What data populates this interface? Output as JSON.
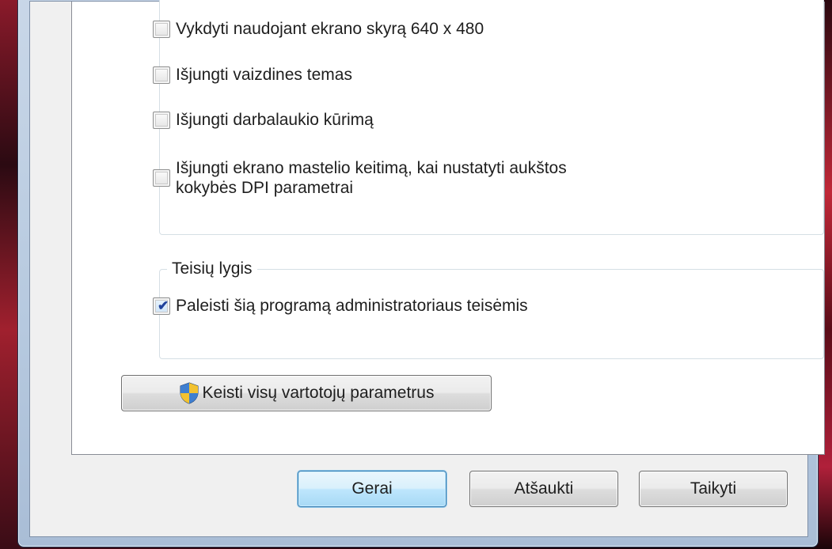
{
  "options": [
    {
      "label": "Vykdyti naudojant ekrano skyrą 640 x 480",
      "checked": false
    },
    {
      "label": "Išjungti vaizdines temas",
      "checked": false
    },
    {
      "label": "Išjungti darbalaukio kūrimą",
      "checked": false
    },
    {
      "label_line1": "Išjungti ekrano mastelio keitimą, kai nustatyti aukštos",
      "label_line2": "kokybės DPI parametrai",
      "checked": false
    }
  ],
  "privilege": {
    "title": "Teisių lygis",
    "run_as_admin": {
      "label": "Paleisti šią programą administratoriaus teisėmis",
      "checked": true,
      "check_glyph": "✔"
    }
  },
  "change_all_users": {
    "label": "Keisti visų vartotojų parametrus",
    "icon": "uac-shield-icon"
  },
  "dialog_buttons": {
    "ok": "Gerai",
    "cancel": "Atšaukti",
    "apply": "Taikyti"
  },
  "colors": {
    "default_button_border": "#3c7fb1",
    "window_frame": "#b6c9df",
    "check_mark": "#21429b"
  }
}
